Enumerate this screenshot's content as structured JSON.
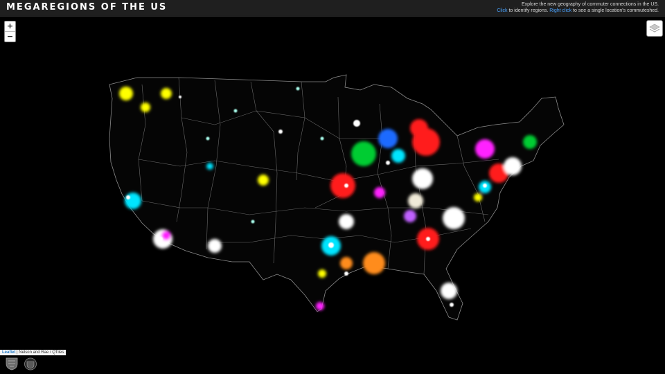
{
  "header": {
    "title": "MEGAREGIONS OF THE US",
    "info_line1": "Explore the new geography of commuter connections in the US.",
    "click_label": "Click",
    "click_text": " to identify regions. ",
    "right_click_label": "Right click",
    "right_click_text": " to see a single location's commuteshed."
  },
  "controls": {
    "zoom_in": "+",
    "zoom_out": "−",
    "layers_icon": "layers-icon"
  },
  "attribution": {
    "leaflet": "Leaflet",
    "credits": " | Nelson and Rae / QTiles"
  },
  "logos": {
    "logo1_icon": "university-shield-icon",
    "logo2_icon": "university-crest-icon"
  },
  "colors": {
    "background": "#000000",
    "topbar": "#1f1f1f",
    "link": "#4aa3ff",
    "boundary": "#8c8c8c",
    "region_colors": [
      "#ff1a1a",
      "#ffff00",
      "#00e5ff",
      "#ffffff",
      "#00cc33",
      "#ff22ff",
      "#1f6bff",
      "#ff8c1a",
      "#c060ff",
      "#aaffee",
      "#f0ead8"
    ]
  }
}
